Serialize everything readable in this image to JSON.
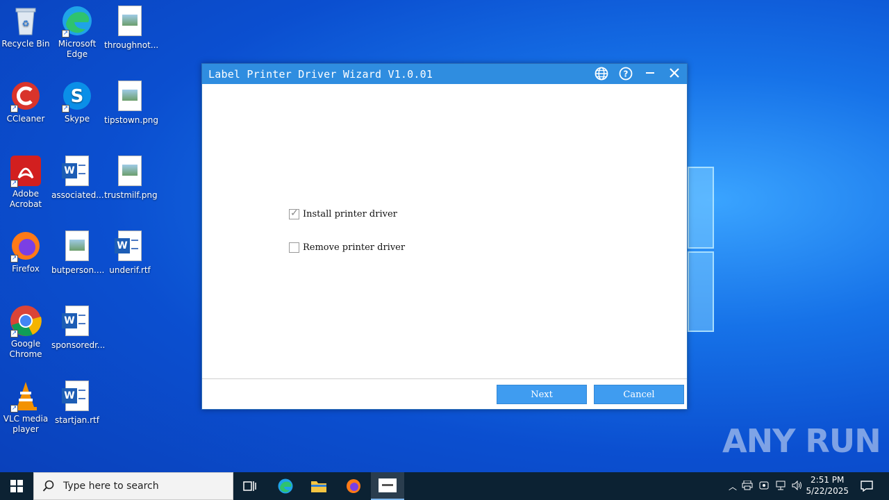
{
  "desktop_icons": [
    {
      "name": "Recycle Bin",
      "key": "recycle"
    },
    {
      "name": "Microsoft Edge",
      "key": "edge"
    },
    {
      "name": "throughnot...",
      "key": "img"
    },
    {
      "name": "CCleaner",
      "key": "ccleaner"
    },
    {
      "name": "Skype",
      "key": "skype"
    },
    {
      "name": "tipstown.png",
      "key": "img"
    },
    {
      "name": "Adobe Acrobat",
      "key": "acrobat"
    },
    {
      "name": "associated...",
      "key": "doc"
    },
    {
      "name": "trustmilf.png",
      "key": "img"
    },
    {
      "name": "Firefox",
      "key": "firefox"
    },
    {
      "name": "butperson....",
      "key": "img"
    },
    {
      "name": "underif.rtf",
      "key": "doc"
    },
    {
      "name": "Google Chrome",
      "key": "chrome"
    },
    {
      "name": "sponsoredr...",
      "key": "doc"
    },
    {
      "name": "VLC media player",
      "key": "vlc"
    },
    {
      "name": "startjan.rtf",
      "key": "doc"
    }
  ],
  "dialog": {
    "title": "Label Printer Driver Wizard  V1.0.01",
    "options": [
      {
        "label": "Install printer driver",
        "checked": true
      },
      {
        "label": "Remove printer driver",
        "checked": false
      }
    ],
    "next_label": "Next",
    "cancel_label": "Cancel"
  },
  "watermark": "ANY RUN",
  "taskbar": {
    "search_placeholder": "Type here to search",
    "time": "2:51 PM",
    "date": "5/22/2025"
  },
  "colors": {
    "titlebar": "#2f8de0",
    "button": "#3f9cf0",
    "taskbar": "#0c2233"
  }
}
